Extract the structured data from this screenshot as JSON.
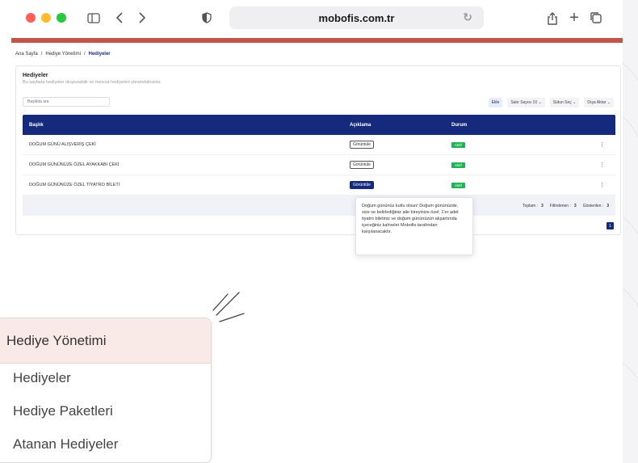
{
  "browser": {
    "url": "mobofis.com.tr"
  },
  "breadcrumb": {
    "home": "Ana Sayfa",
    "sep": "/",
    "parent": "Hediye Yönetimi",
    "current": "Hediyeler"
  },
  "card": {
    "title": "Hediyeler",
    "description": "Bu sayfada hediyeler oluşturabilir ve mevcut hediyeleri yönetebilirsiniz.",
    "search_placeholder": "Başlıkta ara"
  },
  "toolbar": {
    "add": "Ekle",
    "rows": "Satır Sayısı 10 ⌄",
    "columns": "Sütun Seç ⌄",
    "export": "Dışa Aktar ⌄"
  },
  "table": {
    "headers": {
      "title": "Başlık",
      "desc": "Açıklama",
      "status": "Durum"
    },
    "rows": [
      {
        "title": "DOĞUM GÜNÜ ALIŞVERİŞ ÇEKİ",
        "desc_btn": "Görüntüle",
        "status": "Aktif",
        "menu": "⋮"
      },
      {
        "title": "DOĞUM GÜNÜNÜZE ÖZEL AYAKKABI ÇEKİ",
        "desc_btn": "Görüntüle",
        "status": "Aktif",
        "menu": "⋮"
      },
      {
        "title": "DOĞUM GÜNÜNÜZE ÖZEL TİYATRO BİLETİ",
        "desc_btn": "Görüntüle",
        "status": "Aktif",
        "menu": "⋮"
      }
    ],
    "footer": {
      "total_label": "Toplam :",
      "total": "3",
      "filtered_label": "Filtrelenen :",
      "filtered": "3",
      "shown_label": "Gösterilen :",
      "shown": "3"
    },
    "page": "1"
  },
  "tooltip": {
    "text": "Doğum gününüz kutlu olsun! Doğum gününüzde, size ve belirlediğiniz aile bireyinize özel; 1'er adet tiyatro biletiniz ve doğum gününüzün akşamında içeceğiniz kahveler Mobofis tarafından karşılanacaktır."
  },
  "zoom_menu": {
    "header": "Hediye Yönetimi",
    "items": [
      "Hediyeler",
      "Hediye Paketleri",
      "Atanan Hediyeler"
    ]
  },
  "colors": {
    "accent_bar": "#c2554a",
    "table_header": "#162a7d",
    "status_active": "#1fb356"
  }
}
